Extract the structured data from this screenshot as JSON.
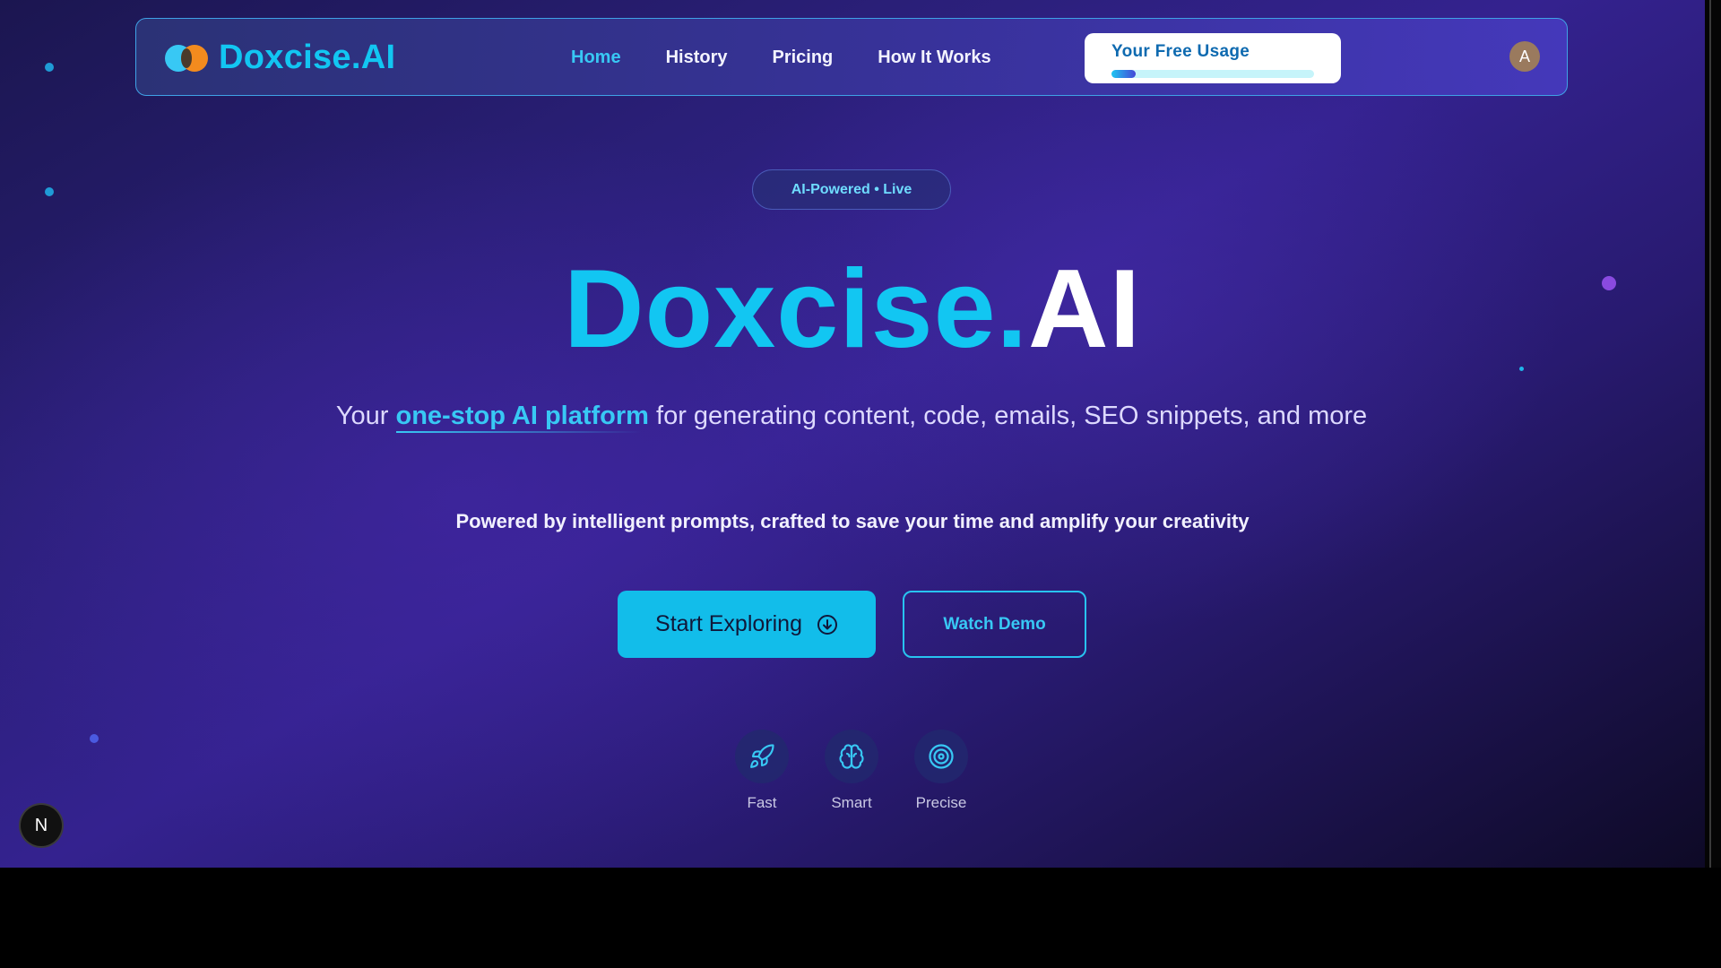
{
  "brand": {
    "name": "Doxcise.AI",
    "logo_icon": "overlapping-circles-logo"
  },
  "nav": {
    "items": [
      {
        "label": "Home",
        "active": true
      },
      {
        "label": "History",
        "active": false
      },
      {
        "label": "Pricing",
        "active": false
      },
      {
        "label": "How It Works",
        "active": false
      }
    ]
  },
  "usage": {
    "label": "Your Free Usage",
    "progress_fraction": 0.12
  },
  "user": {
    "avatar_initial": "A"
  },
  "hero": {
    "badge": "AI-Powered • Live",
    "title_part1": "Doxcise.",
    "title_part2": "AI",
    "subtitle_pre": "Your",
    "subtitle_highlight": "one-stop AI platform",
    "subtitle_post": "for generating content, code, emails, SEO snippets, and more",
    "tagline": "Powered by intelligent prompts, crafted to save your time and amplify your creativity"
  },
  "actions": {
    "primary_label": "Start Exploring",
    "primary_icon": "arrow-down-circle-icon",
    "secondary_label": "Watch Demo"
  },
  "features": [
    {
      "label": "Fast",
      "icon": "rocket-icon"
    },
    {
      "label": "Smart",
      "icon": "brain-icon"
    },
    {
      "label": "Precise",
      "icon": "target-icon"
    }
  ],
  "dev_badge": {
    "label": "N"
  },
  "colors": {
    "accent": "#12c6f2",
    "orange": "#f38b1e",
    "background_deep": "#1b1650",
    "background_mid": "#34228f"
  }
}
